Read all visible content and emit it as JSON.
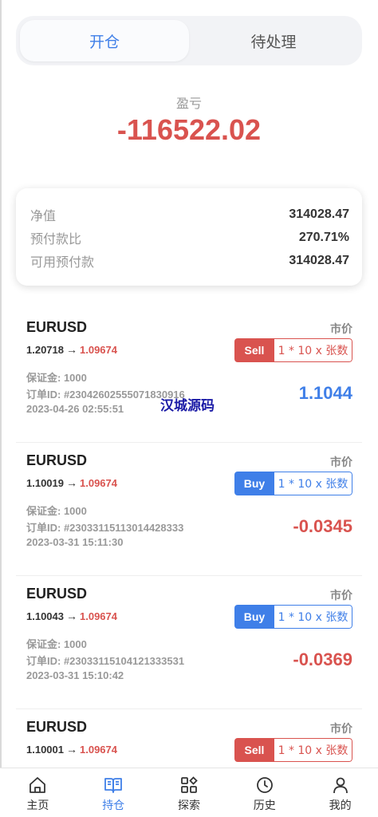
{
  "tabs": [
    {
      "label": "开仓",
      "active": true
    },
    {
      "label": "待处理",
      "active": false
    }
  ],
  "pnl": {
    "label": "盈亏",
    "value": "-116522.02"
  },
  "summary": [
    {
      "label": "净值",
      "value": "314028.47"
    },
    {
      "label": "预付款比",
      "value": "270.71%"
    },
    {
      "label": "可用预付款",
      "value": "314028.47"
    }
  ],
  "orders": [
    {
      "symbol": "EURUSD",
      "market": "市价",
      "open_price": "1.20718",
      "arrow": "→",
      "current_price": "1.09674",
      "side": "Sell",
      "lots": "1 * 10 x 张数",
      "margin": "保证金: 1000",
      "order_id": "订单ID: #230426025550718309​16",
      "time": "2023-04-26 02:55:51",
      "profit": "1.1044"
    },
    {
      "symbol": "EURUSD",
      "market": "市价",
      "open_price": "1.10019",
      "arrow": "→",
      "current_price": "1.09674",
      "side": "Buy",
      "lots": "1 * 10 x 张数",
      "margin": "保证金: 1000",
      "order_id": "订单ID: #230331151130144283​33",
      "time": "2023-03-31 15:11:30",
      "profit": "-0.0345"
    },
    {
      "symbol": "EURUSD",
      "market": "市价",
      "open_price": "1.10043",
      "arrow": "→",
      "current_price": "1.09674",
      "side": "Buy",
      "lots": "1 * 10 x 张数",
      "margin": "保证金: 1000",
      "order_id": "订单ID: #230331151041213335​31",
      "time": "2023-03-31 15:10:42",
      "profit": "-0.0369"
    },
    {
      "symbol": "EURUSD",
      "market": "市价",
      "open_price": "1.10001",
      "arrow": "→",
      "current_price": "1.09674",
      "side": "Sell",
      "lots": "1 * 10 x 张数",
      "margin": "",
      "order_id": "",
      "time": "",
      "profit": ""
    }
  ],
  "watermark": "汉城源码",
  "nav": [
    {
      "label": "主页",
      "icon": "home-icon",
      "active": false
    },
    {
      "label": "持仓",
      "icon": "book-icon",
      "active": true
    },
    {
      "label": "探索",
      "icon": "grid-icon",
      "active": false
    },
    {
      "label": "历史",
      "icon": "clock-icon",
      "active": false
    },
    {
      "label": "我的",
      "icon": "user-icon",
      "active": false
    }
  ],
  "colors": {
    "accent": "#3f7fe8",
    "negative": "#d9534f"
  }
}
